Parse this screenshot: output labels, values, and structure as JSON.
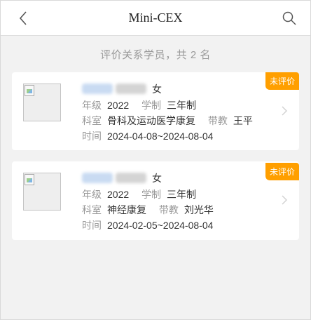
{
  "header": {
    "title": "Mini-CEX"
  },
  "summary": "评价关系学员，共 2 名",
  "labels": {
    "grade": "年级",
    "system": "学制",
    "department": "科室",
    "teacher": "带教",
    "time": "时间"
  },
  "students": [
    {
      "gender": "女",
      "grade": "2022",
      "system": "三年制",
      "department": "骨科及运动医学康复",
      "teacher": "王平",
      "time": "2024-04-08~2024-08-04",
      "badge": "未评价"
    },
    {
      "gender": "女",
      "grade": "2022",
      "system": "三年制",
      "department": "神经康复",
      "teacher": "刘光华",
      "time": "2024-02-05~2024-08-04",
      "badge": "未评价"
    }
  ],
  "colors": {
    "badge": "#ff9f00",
    "page_bg": "#f2f2f2"
  },
  "icons": {
    "back": "chevron-left-icon",
    "search": "search-icon",
    "row_arrow": "chevron-right-icon"
  }
}
